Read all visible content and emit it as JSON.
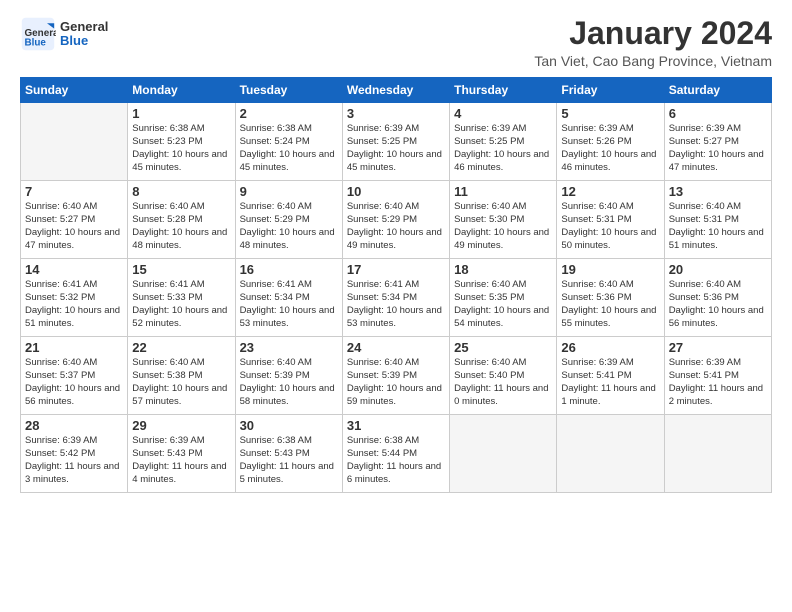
{
  "header": {
    "logo_general": "General",
    "logo_blue": "Blue",
    "month_title": "January 2024",
    "location": "Tan Viet, Cao Bang Province, Vietnam"
  },
  "days_of_week": [
    "Sunday",
    "Monday",
    "Tuesday",
    "Wednesday",
    "Thursday",
    "Friday",
    "Saturday"
  ],
  "weeks": [
    [
      {
        "day": "",
        "sunrise": "",
        "sunset": "",
        "daylight": ""
      },
      {
        "day": "1",
        "sunrise": "Sunrise: 6:38 AM",
        "sunset": "Sunset: 5:23 PM",
        "daylight": "Daylight: 10 hours and 45 minutes."
      },
      {
        "day": "2",
        "sunrise": "Sunrise: 6:38 AM",
        "sunset": "Sunset: 5:24 PM",
        "daylight": "Daylight: 10 hours and 45 minutes."
      },
      {
        "day": "3",
        "sunrise": "Sunrise: 6:39 AM",
        "sunset": "Sunset: 5:25 PM",
        "daylight": "Daylight: 10 hours and 45 minutes."
      },
      {
        "day": "4",
        "sunrise": "Sunrise: 6:39 AM",
        "sunset": "Sunset: 5:25 PM",
        "daylight": "Daylight: 10 hours and 46 minutes."
      },
      {
        "day": "5",
        "sunrise": "Sunrise: 6:39 AM",
        "sunset": "Sunset: 5:26 PM",
        "daylight": "Daylight: 10 hours and 46 minutes."
      },
      {
        "day": "6",
        "sunrise": "Sunrise: 6:39 AM",
        "sunset": "Sunset: 5:27 PM",
        "daylight": "Daylight: 10 hours and 47 minutes."
      }
    ],
    [
      {
        "day": "7",
        "sunrise": "Sunrise: 6:40 AM",
        "sunset": "Sunset: 5:27 PM",
        "daylight": "Daylight: 10 hours and 47 minutes."
      },
      {
        "day": "8",
        "sunrise": "Sunrise: 6:40 AM",
        "sunset": "Sunset: 5:28 PM",
        "daylight": "Daylight: 10 hours and 48 minutes."
      },
      {
        "day": "9",
        "sunrise": "Sunrise: 6:40 AM",
        "sunset": "Sunset: 5:29 PM",
        "daylight": "Daylight: 10 hours and 48 minutes."
      },
      {
        "day": "10",
        "sunrise": "Sunrise: 6:40 AM",
        "sunset": "Sunset: 5:29 PM",
        "daylight": "Daylight: 10 hours and 49 minutes."
      },
      {
        "day": "11",
        "sunrise": "Sunrise: 6:40 AM",
        "sunset": "Sunset: 5:30 PM",
        "daylight": "Daylight: 10 hours and 49 minutes."
      },
      {
        "day": "12",
        "sunrise": "Sunrise: 6:40 AM",
        "sunset": "Sunset: 5:31 PM",
        "daylight": "Daylight: 10 hours and 50 minutes."
      },
      {
        "day": "13",
        "sunrise": "Sunrise: 6:40 AM",
        "sunset": "Sunset: 5:31 PM",
        "daylight": "Daylight: 10 hours and 51 minutes."
      }
    ],
    [
      {
        "day": "14",
        "sunrise": "Sunrise: 6:41 AM",
        "sunset": "Sunset: 5:32 PM",
        "daylight": "Daylight: 10 hours and 51 minutes."
      },
      {
        "day": "15",
        "sunrise": "Sunrise: 6:41 AM",
        "sunset": "Sunset: 5:33 PM",
        "daylight": "Daylight: 10 hours and 52 minutes."
      },
      {
        "day": "16",
        "sunrise": "Sunrise: 6:41 AM",
        "sunset": "Sunset: 5:34 PM",
        "daylight": "Daylight: 10 hours and 53 minutes."
      },
      {
        "day": "17",
        "sunrise": "Sunrise: 6:41 AM",
        "sunset": "Sunset: 5:34 PM",
        "daylight": "Daylight: 10 hours and 53 minutes."
      },
      {
        "day": "18",
        "sunrise": "Sunrise: 6:40 AM",
        "sunset": "Sunset: 5:35 PM",
        "daylight": "Daylight: 10 hours and 54 minutes."
      },
      {
        "day": "19",
        "sunrise": "Sunrise: 6:40 AM",
        "sunset": "Sunset: 5:36 PM",
        "daylight": "Daylight: 10 hours and 55 minutes."
      },
      {
        "day": "20",
        "sunrise": "Sunrise: 6:40 AM",
        "sunset": "Sunset: 5:36 PM",
        "daylight": "Daylight: 10 hours and 56 minutes."
      }
    ],
    [
      {
        "day": "21",
        "sunrise": "Sunrise: 6:40 AM",
        "sunset": "Sunset: 5:37 PM",
        "daylight": "Daylight: 10 hours and 56 minutes."
      },
      {
        "day": "22",
        "sunrise": "Sunrise: 6:40 AM",
        "sunset": "Sunset: 5:38 PM",
        "daylight": "Daylight: 10 hours and 57 minutes."
      },
      {
        "day": "23",
        "sunrise": "Sunrise: 6:40 AM",
        "sunset": "Sunset: 5:39 PM",
        "daylight": "Daylight: 10 hours and 58 minutes."
      },
      {
        "day": "24",
        "sunrise": "Sunrise: 6:40 AM",
        "sunset": "Sunset: 5:39 PM",
        "daylight": "Daylight: 10 hours and 59 minutes."
      },
      {
        "day": "25",
        "sunrise": "Sunrise: 6:40 AM",
        "sunset": "Sunset: 5:40 PM",
        "daylight": "Daylight: 11 hours and 0 minutes."
      },
      {
        "day": "26",
        "sunrise": "Sunrise: 6:39 AM",
        "sunset": "Sunset: 5:41 PM",
        "daylight": "Daylight: 11 hours and 1 minute."
      },
      {
        "day": "27",
        "sunrise": "Sunrise: 6:39 AM",
        "sunset": "Sunset: 5:41 PM",
        "daylight": "Daylight: 11 hours and 2 minutes."
      }
    ],
    [
      {
        "day": "28",
        "sunrise": "Sunrise: 6:39 AM",
        "sunset": "Sunset: 5:42 PM",
        "daylight": "Daylight: 11 hours and 3 minutes."
      },
      {
        "day": "29",
        "sunrise": "Sunrise: 6:39 AM",
        "sunset": "Sunset: 5:43 PM",
        "daylight": "Daylight: 11 hours and 4 minutes."
      },
      {
        "day": "30",
        "sunrise": "Sunrise: 6:38 AM",
        "sunset": "Sunset: 5:43 PM",
        "daylight": "Daylight: 11 hours and 5 minutes."
      },
      {
        "day": "31",
        "sunrise": "Sunrise: 6:38 AM",
        "sunset": "Sunset: 5:44 PM",
        "daylight": "Daylight: 11 hours and 6 minutes."
      },
      {
        "day": "",
        "sunrise": "",
        "sunset": "",
        "daylight": ""
      },
      {
        "day": "",
        "sunrise": "",
        "sunset": "",
        "daylight": ""
      },
      {
        "day": "",
        "sunrise": "",
        "sunset": "",
        "daylight": ""
      }
    ]
  ]
}
